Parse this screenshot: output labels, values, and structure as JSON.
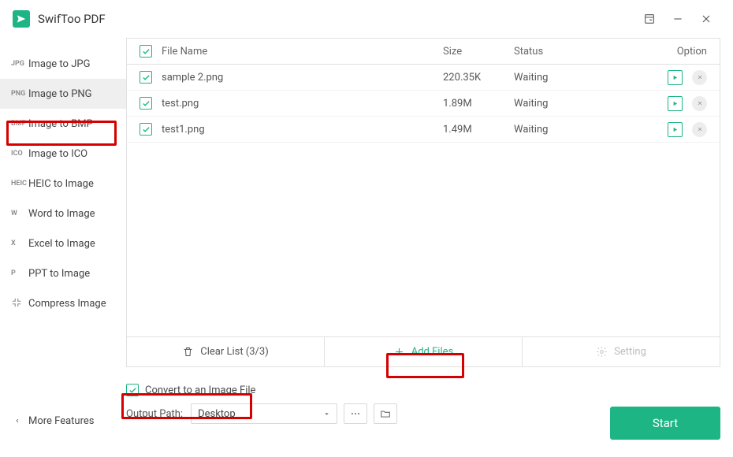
{
  "app": {
    "title": "SwifToo PDF"
  },
  "titlebar": {
    "maximize_tooltip": "",
    "minimize": "",
    "close": ""
  },
  "sidebar": {
    "items": [
      {
        "tag": "JPG",
        "label": "Image to JPG"
      },
      {
        "tag": "PNG",
        "label": "Image to PNG"
      },
      {
        "tag": "BMP",
        "label": "Image to BMP"
      },
      {
        "tag": "ICO",
        "label": "Image to ICO"
      },
      {
        "tag": "HEIC",
        "label": "HEIC to Image"
      },
      {
        "tag": "W",
        "label": "Word to Image"
      },
      {
        "tag": "X",
        "label": "Excel to Image"
      },
      {
        "tag": "P",
        "label": "PPT to Image"
      },
      {
        "tag": "",
        "label": "Compress Image"
      }
    ],
    "active_index": 1,
    "more": "More Features"
  },
  "table": {
    "headers": {
      "name": "File Name",
      "size": "Size",
      "status": "Status",
      "option": "Option"
    },
    "rows": [
      {
        "name": "sample 2.png",
        "size": "220.35K",
        "status": "Waiting"
      },
      {
        "name": "test.png",
        "size": "1.89M",
        "status": "Waiting"
      },
      {
        "name": "test1.png",
        "size": "1.49M",
        "status": "Waiting"
      }
    ]
  },
  "toolbar": {
    "clear": "Clear List (3/3)",
    "add": "Add Files",
    "setting": "Setting"
  },
  "bottom": {
    "convert_label": "Convert to an Image File",
    "output_label": "Output Path:",
    "output_value": "Desktop",
    "start": "Start"
  },
  "colors": {
    "accent": "#1db583",
    "highlight": "#d60000"
  }
}
